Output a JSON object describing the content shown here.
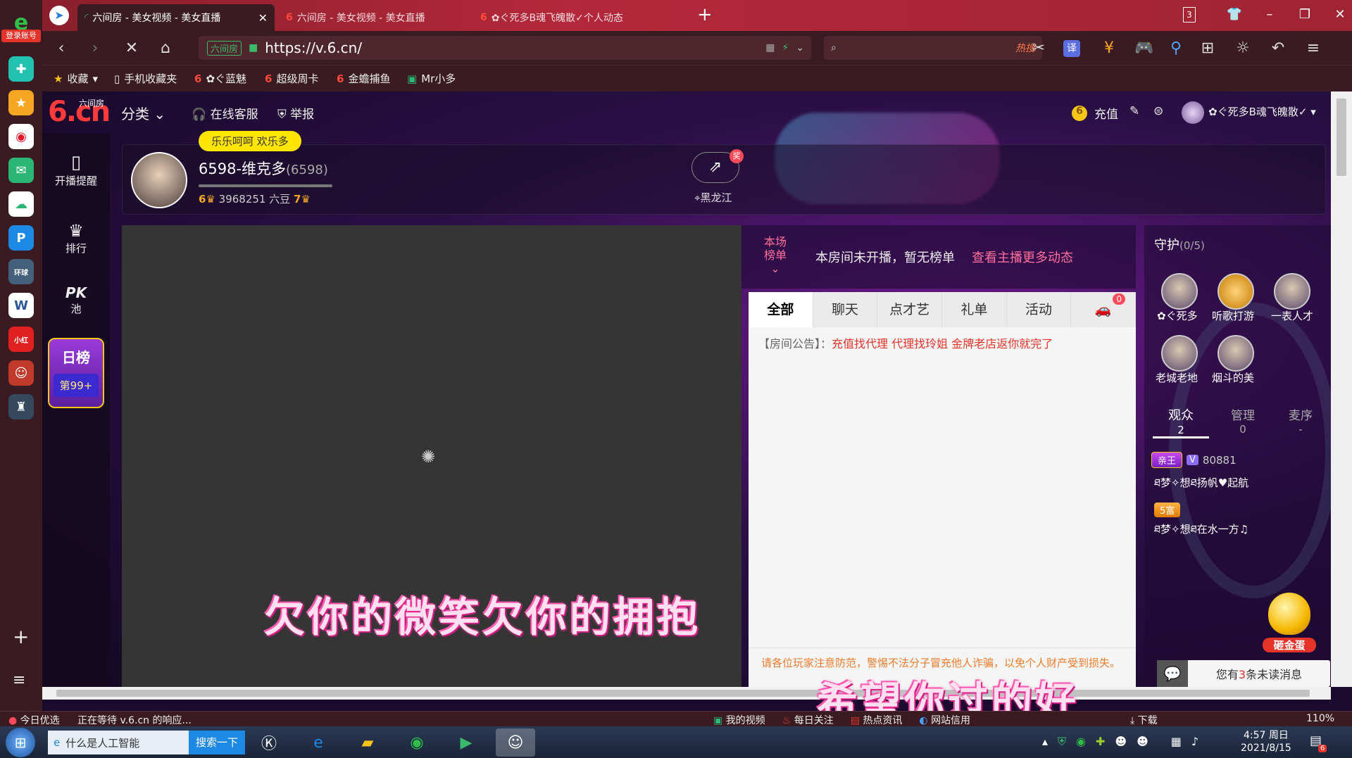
{
  "browser": {
    "tabs": [
      {
        "label": "六间房 - 美女视频 - 美女直播",
        "active": true
      },
      {
        "label": "六间房 - 美女视频 - 美女直播",
        "active": false
      },
      {
        "label": "✿ぐ死多B魂飞魄散✓个人动态",
        "active": false
      }
    ],
    "new_tab": "+",
    "tab_count": "3",
    "url": "https://v.6.cn/",
    "site_badge": "六间房",
    "search_hot": "热搜",
    "translate": "译",
    "login_badge": "登录账号",
    "bookmarks": [
      {
        "label": "收藏",
        "icon": "star-icon"
      },
      {
        "label": "手机收藏夹",
        "icon": "phone-icon"
      },
      {
        "label": "✿ぐ蓝魅",
        "icon": "six-icon"
      },
      {
        "label": "超级周卡",
        "icon": "six-icon"
      },
      {
        "label": "金蟾捕鱼",
        "icon": "six-icon"
      },
      {
        "label": "Mr小多",
        "icon": "mr-icon"
      }
    ],
    "status_text": "正在等待 v.6.cn 的响应...",
    "status_left": "今日优选",
    "status_items": [
      "我的视频",
      "每日关注",
      "热点资讯",
      "网站信用",
      "下载"
    ],
    "zoom": "110%"
  },
  "site": {
    "logo_main": "6.cn",
    "logo_sub": "六间房",
    "nav": [
      "分类",
      "在线客服",
      "举报"
    ],
    "recharge": "充值",
    "user_name": "✿ぐ死多B魂飞魄散✓",
    "sidebar": [
      {
        "label": "开播提醒",
        "icon": "phone-icon"
      },
      {
        "label": "排行",
        "icon": "crown-icon"
      },
      {
        "label": "池",
        "icon": "pk-icon",
        "prefix": "PK"
      }
    ],
    "daily_rank": {
      "title": "日榜",
      "value": "第99+"
    }
  },
  "anchor": {
    "tooltip": "乐乐呵呵 欢乐多",
    "name": "6598-维克多",
    "room_id": "(6598)",
    "level": "6",
    "beans": "3968251 六豆",
    "wealth_level": "7",
    "location": "黑龙江",
    "share_badge": "奖"
  },
  "video": {
    "lyric_line1": "欠你的微笑欠你的拥抱",
    "lyric_line2": "希望你过的好"
  },
  "chat": {
    "rank_label": "本场榜单",
    "rank_msg": "本房间未开播，暂无榜单",
    "rank_link": "查看主播更多动态",
    "tabs": [
      "全部",
      "聊天",
      "点才艺",
      "礼单",
      "活动"
    ],
    "car_badge": "0",
    "notice_prefix": "【房间公告】：",
    "notice_text": "充值找代理 代理找玲姐 金牌老店返你就完了",
    "warning": "请各位玩家注意防范，警惕不法分子冒充他人诈骗，以免个人财产受到损失。"
  },
  "guard": {
    "title": "守护",
    "count": "(0/5)",
    "members": [
      "✿ぐ死多",
      "听歌打游",
      "一表人才",
      "老城老地",
      "烟斗的美"
    ],
    "tabs": [
      {
        "label": "观众",
        "count": "2"
      },
      {
        "label": "管理",
        "count": "0"
      },
      {
        "label": "麦序",
        "count": "-"
      }
    ],
    "viewers": [
      {
        "badge": "亲王",
        "vip": "V",
        "id": "80881",
        "name": "ཐ梦✧想ཐ扬帆♥起航"
      },
      {
        "badge": "5富",
        "name": "ཐ梦✧想ཐ在水一方♫"
      }
    ],
    "egg_label": "砸金蛋",
    "unread_prefix": "您有",
    "unread_count": "3",
    "unread_suffix": "条未读消息"
  },
  "taskbar": {
    "search_text": "什么是人工智能",
    "search_button": "搜索一下",
    "time": "4:57 周日",
    "date": "2021/8/15",
    "notif": "6"
  }
}
